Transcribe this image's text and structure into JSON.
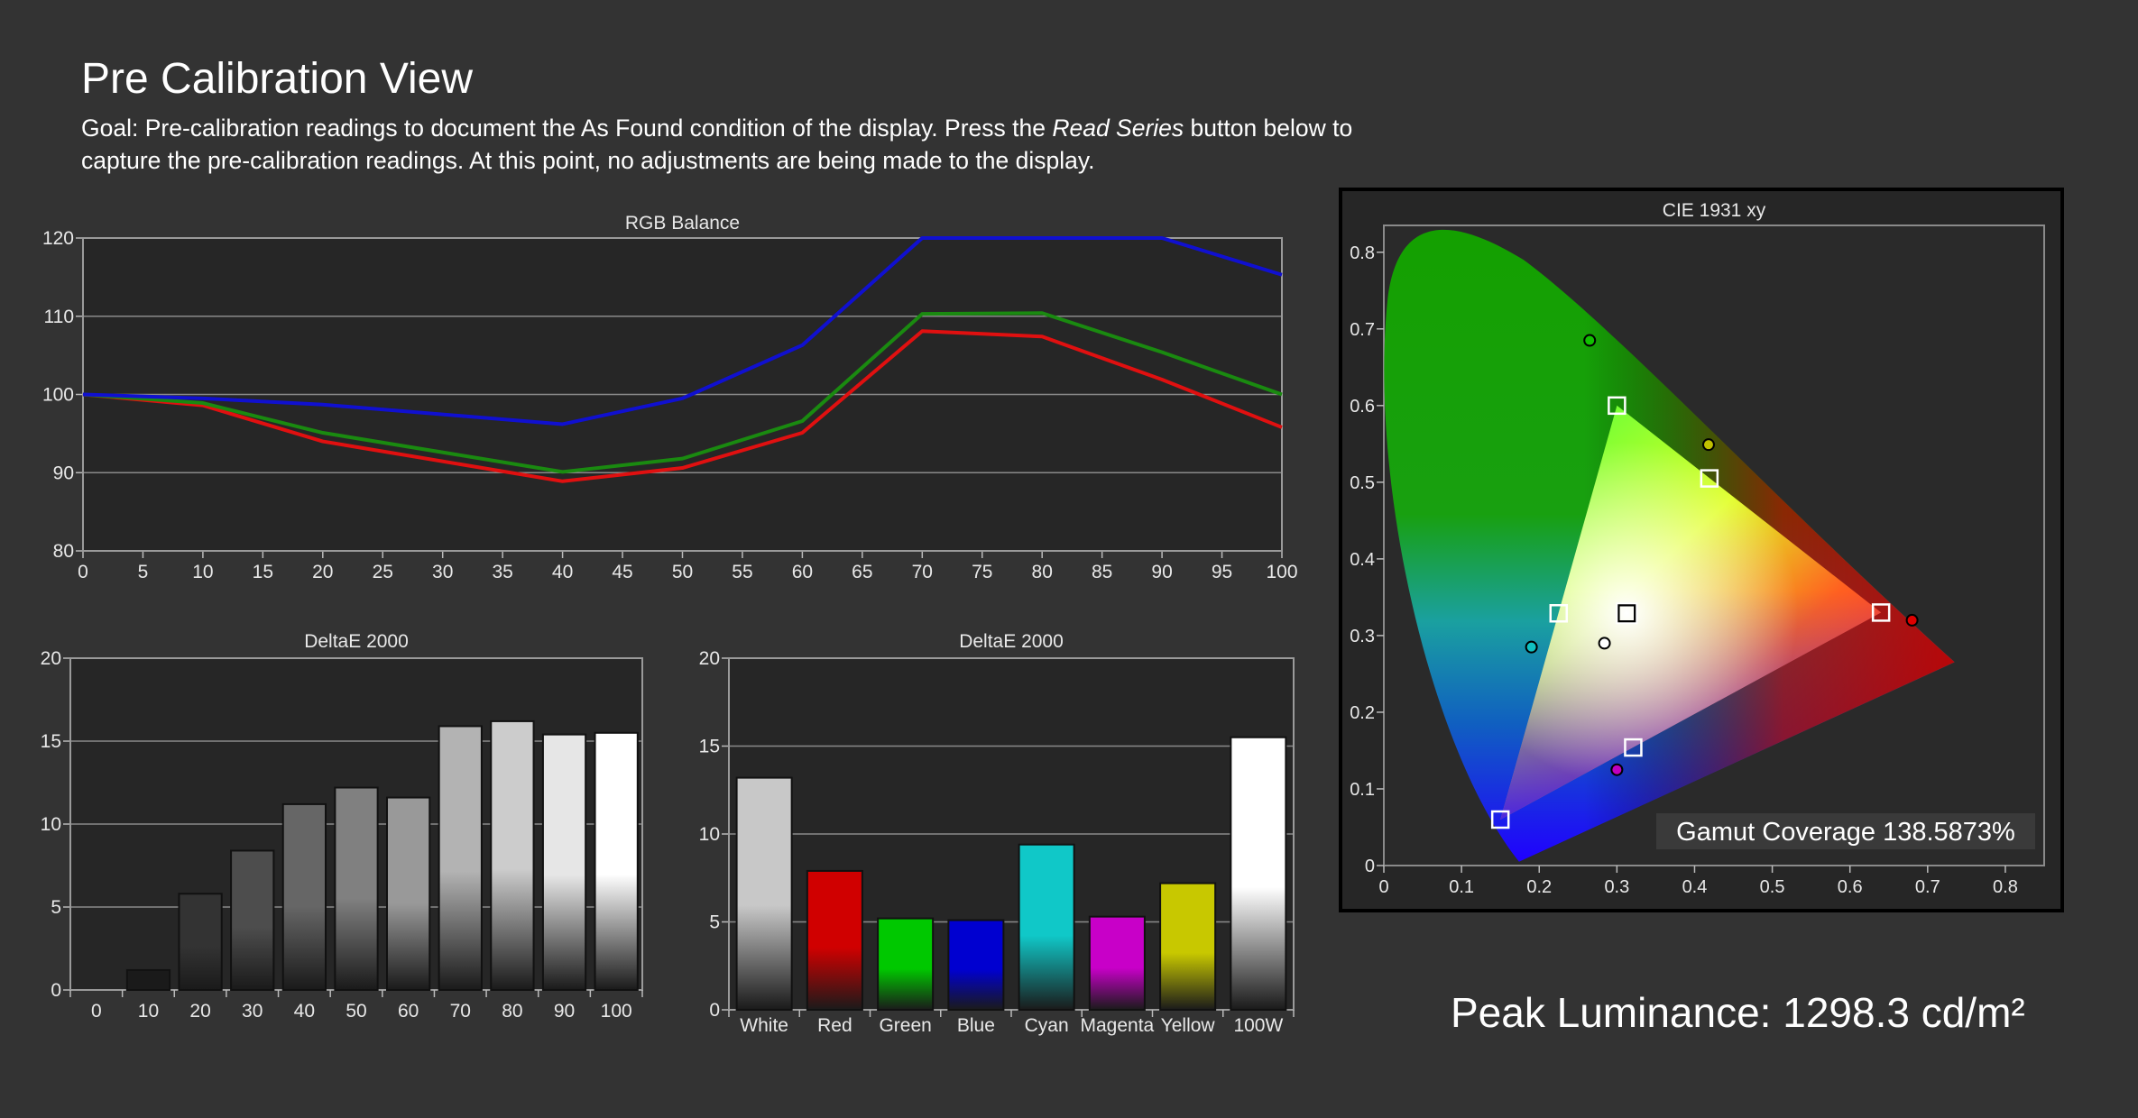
{
  "header": {
    "title": "Pre Calibration View",
    "goal_before": "Goal: Pre-calibration readings to document the As Found condition of the display. Press the ",
    "goal_emphasis": "Read Series",
    "goal_after": " button below to capture the pre-calibration readings. At this point, no adjustments are being made to the display."
  },
  "peak": {
    "label": "Peak Luminance: ",
    "value": "1298.3",
    "unit": "cd/m²"
  },
  "chart_data": [
    {
      "id": "rgb-balance",
      "type": "line",
      "title": "RGB Balance",
      "x": [
        0,
        10,
        20,
        40,
        50,
        60,
        70,
        80,
        90,
        100
      ],
      "xticks": [
        0,
        5,
        10,
        15,
        20,
        25,
        30,
        35,
        40,
        45,
        50,
        55,
        60,
        65,
        70,
        75,
        80,
        85,
        90,
        95,
        100
      ],
      "yticks": [
        80,
        90,
        100,
        110,
        120
      ],
      "xlim": [
        0,
        100
      ],
      "ylim": [
        80,
        120
      ],
      "grid": true,
      "series": [
        {
          "color": "#e01010",
          "values": [
            100,
            98.6,
            94.0,
            88.9,
            90.6,
            95.1,
            108.1,
            107.4,
            101.9,
            95.8
          ]
        },
        {
          "color": "#1a8a10",
          "values": [
            100,
            98.9,
            95.1,
            90.1,
            91.8,
            96.6,
            110.3,
            110.4,
            105.4,
            100.0
          ]
        },
        {
          "color": "#1010d0",
          "values": [
            100,
            99.5,
            98.7,
            96.2,
            99.5,
            106.3,
            120,
            120,
            120,
            115.3
          ]
        }
      ]
    },
    {
      "id": "deltae-grayscale",
      "type": "bar",
      "title": "DeltaE 2000",
      "categories": [
        "0",
        "10",
        "20",
        "30",
        "40",
        "50",
        "60",
        "70",
        "80",
        "90",
        "100"
      ],
      "values": [
        0,
        1.2,
        5.8,
        8.4,
        11.2,
        12.2,
        11.6,
        15.9,
        16.2,
        15.4,
        15.5
      ],
      "colors": [
        "#000000",
        "#1a1a1a",
        "#333333",
        "#4d4d4d",
        "#666666",
        "#808080",
        "#999999",
        "#b3b3b3",
        "#cccccc",
        "#e6e6e6",
        "#ffffff"
      ],
      "yticks": [
        0,
        5,
        10,
        15,
        20
      ],
      "ylim": [
        0,
        20
      ],
      "grid": true
    },
    {
      "id": "deltae-colors",
      "type": "bar",
      "title": "DeltaE 2000",
      "categories": [
        "White",
        "Red",
        "Green",
        "Blue",
        "Cyan",
        "Magenta",
        "Yellow",
        "100W"
      ],
      "values": [
        13.2,
        7.9,
        5.2,
        5.1,
        9.4,
        5.3,
        7.2,
        15.5
      ],
      "colors": [
        "#c8c8c8",
        "#d00000",
        "#00c800",
        "#0000d0",
        "#10c8c8",
        "#c800c8",
        "#c8c800",
        "#ffffff"
      ],
      "yticks": [
        0,
        5,
        10,
        15,
        20
      ],
      "ylim": [
        0,
        20
      ],
      "grid": true
    },
    {
      "id": "cie-1931",
      "type": "scatter",
      "title": "CIE 1931 xy",
      "xticks": [
        "0",
        "0.1",
        "0.2",
        "0.3",
        "0.4",
        "0.5",
        "0.6",
        "0.7",
        "0.8"
      ],
      "yticks": [
        "0",
        "0.1",
        "0.2",
        "0.3",
        "0.4",
        "0.5",
        "0.6",
        "0.7",
        "0.8"
      ],
      "xlim": [
        0,
        0.85
      ],
      "ylim": [
        0,
        0.835
      ],
      "targets": [
        {
          "name": "Red",
          "x": 0.64,
          "y": 0.33
        },
        {
          "name": "Green",
          "x": 0.3,
          "y": 0.6
        },
        {
          "name": "Blue",
          "x": 0.15,
          "y": 0.06
        },
        {
          "name": "Cyan",
          "x": 0.225,
          "y": 0.329
        },
        {
          "name": "Magenta",
          "x": 0.321,
          "y": 0.154
        },
        {
          "name": "Yellow",
          "x": 0.419,
          "y": 0.505
        },
        {
          "name": "White",
          "x": 0.3127,
          "y": 0.329
        }
      ],
      "measured": [
        {
          "name": "Red",
          "x": 0.68,
          "y": 0.32,
          "color": "#e00000"
        },
        {
          "name": "Green",
          "x": 0.265,
          "y": 0.685,
          "color": "#10c000"
        },
        {
          "name": "Cyan",
          "x": 0.19,
          "y": 0.285,
          "color": "#10c0c0"
        },
        {
          "name": "Magenta",
          "x": 0.3,
          "y": 0.125,
          "color": "#c000c0"
        },
        {
          "name": "Yellow",
          "x": 0.418,
          "y": 0.549,
          "color": "#c0c000"
        },
        {
          "name": "White",
          "x": 0.284,
          "y": 0.29,
          "color": "#ffffff"
        }
      ],
      "annotation_label": "Gamut Coverage ",
      "annotation_value": "138.5873%"
    }
  ]
}
